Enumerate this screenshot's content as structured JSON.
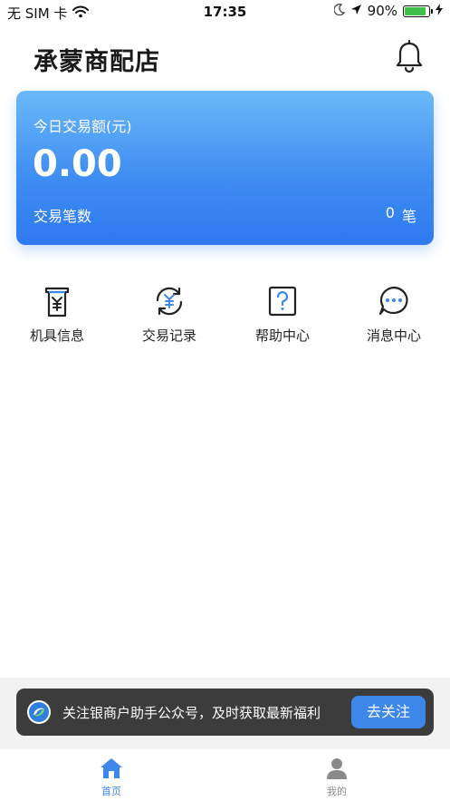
{
  "status_bar": {
    "carrier": "无 SIM 卡",
    "time": "17:35",
    "battery": "90%",
    "battery_level": 0.9,
    "icons": [
      "wifi-icon",
      "moon-icon",
      "location-arrow-icon",
      "battery-icon",
      "charging-bolt-icon"
    ]
  },
  "header": {
    "title": "承蒙商配店",
    "icon": "bell-icon"
  },
  "summary_card": {
    "amount_label": "今日交易额(元)",
    "amount": "0.00",
    "count_label": "交易笔数",
    "count_value": "0",
    "count_unit": "笔"
  },
  "menu": [
    {
      "label": "机具信息",
      "icon": "pos-terminal-icon"
    },
    {
      "label": "交易记录",
      "icon": "yuan-refresh-icon"
    },
    {
      "label": "帮助中心",
      "icon": "help-question-icon"
    },
    {
      "label": "消息中心",
      "icon": "message-bubble-icon"
    }
  ],
  "banner": {
    "text": "关注银商户助手公众号，及时获取最新福利",
    "button": "去关注",
    "icon": "brand-logo-icon"
  },
  "tabbar": [
    {
      "label": "首页",
      "icon": "home-icon",
      "active": true
    },
    {
      "label": "我的",
      "icon": "user-icon",
      "active": false
    }
  ],
  "colors": {
    "accent": "#3d86ea",
    "card_gradient_top": "#6bb9f9",
    "card_gradient_bottom": "#2f79ef",
    "tab_active": "#3d86ea",
    "tab_inactive": "#8a8a8a",
    "banner_bg": "#3c3c3c"
  }
}
